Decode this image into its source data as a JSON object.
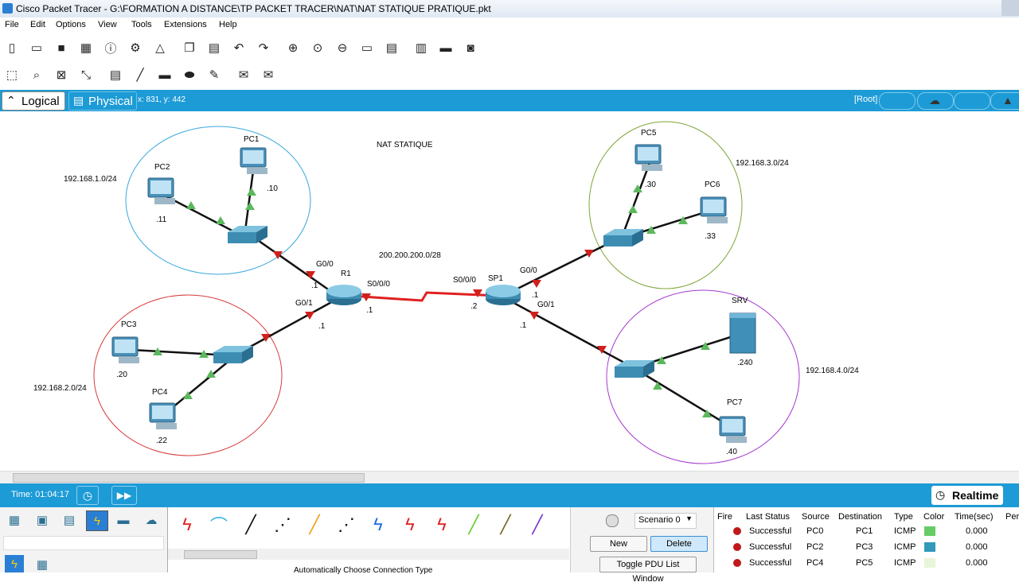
{
  "window": {
    "title": "Cisco Packet Tracer - G:\\FORMATION A DISTANCE\\TP PACKET TRACER\\NAT\\NAT STATIQUE PRATIQUE.pkt"
  },
  "menu": [
    "File",
    "Edit",
    "Options",
    "View",
    "Tools",
    "Extensions",
    "Help"
  ],
  "workspace": {
    "logical_label": "Logical",
    "physical_label": "Physical",
    "coords": "x: 831, y: 442",
    "root_label": "[Root]"
  },
  "topology": {
    "title": "NAT STATIQUE",
    "wan_network": "200.200.200.0/28",
    "networks": {
      "lan1": "192.168.1.0/24",
      "lan2": "192.168.2.0/24",
      "lan3": "192.168.3.0/24",
      "lan4": "192.168.4.0/24"
    },
    "devices": {
      "pc1": {
        "name": "PC1",
        "ip": ".10"
      },
      "pc2": {
        "name": "PC2",
        "ip": ".11"
      },
      "pc3": {
        "name": "PC3",
        "ip": ".20"
      },
      "pc4": {
        "name": "PC4",
        "ip": ".22"
      },
      "pc5": {
        "name": "PC5",
        "ip": ".30"
      },
      "pc6": {
        "name": "PC6",
        "ip": ".33"
      },
      "pc7": {
        "name": "PC7",
        "ip": ".40"
      },
      "srv": {
        "name": "SRV",
        "ip": ".240"
      },
      "r1": {
        "name": "R1"
      },
      "sp1": {
        "name": "SP1"
      }
    },
    "interfaces": {
      "r1_g00": "G0/0",
      "r1_g00_ip": ".1",
      "r1_g01": "G0/1",
      "r1_g01_ip": ".1",
      "r1_s000": "S0/0/0",
      "r1_s000_ip": ".1",
      "sp1_s000": "S0/0/0",
      "sp1_s000_ip": ".2",
      "sp1_g00": "G0/0",
      "sp1_g00_ip": ".1",
      "sp1_g01": "G0/1",
      "sp1_g01_ip": ".1"
    }
  },
  "status": {
    "time": "Time: 01:04:17",
    "mode": "Realtime"
  },
  "scenario": {
    "selected": "Scenario 0",
    "new_label": "New",
    "delete_label": "Delete",
    "toggle_label": "Toggle PDU List Window"
  },
  "connection_hint": "Automatically Choose Connection Type",
  "pdu_table": {
    "headers": [
      "Fire",
      "Last Status",
      "Source",
      "Destination",
      "Type",
      "Color",
      "Time(sec)",
      "Per"
    ],
    "rows": [
      {
        "status": "Successful",
        "source": "PC0",
        "destination": "PC1",
        "type": "ICMP",
        "color": "#66cc66",
        "time": "0.000"
      },
      {
        "status": "Successful",
        "source": "PC2",
        "destination": "PC3",
        "type": "ICMP",
        "color": "#3399bb",
        "time": "0.000"
      },
      {
        "status": "Successful",
        "source": "PC4",
        "destination": "PC5",
        "type": "ICMP",
        "color": "#e8f5d8",
        "time": "0.000"
      }
    ]
  },
  "colors": {
    "accent_blue": "#1d9bd6",
    "lan1_circle": "#3aa8dc",
    "lan2_circle": "#d83a3a",
    "lan3_circle": "#7fa63a",
    "lan4_circle": "#a63ad0",
    "serial_link": "#e02020",
    "port_up": "#5cb85c",
    "port_down": "#d0201c"
  }
}
